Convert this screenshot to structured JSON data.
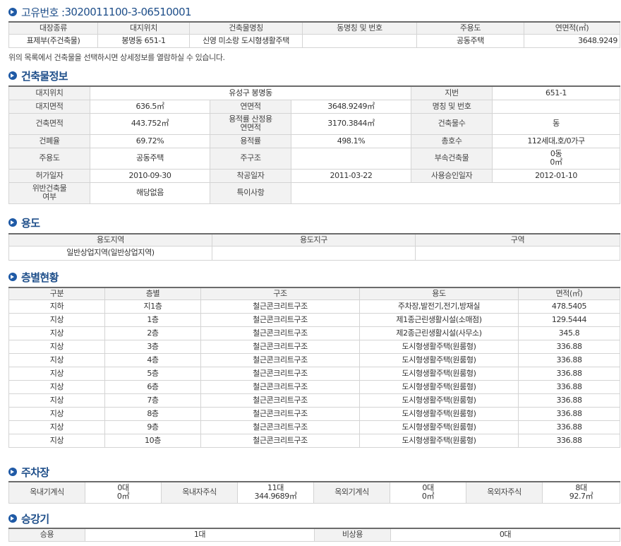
{
  "unique_id": {
    "label": "고유번호 : ",
    "value": "3020011100-3-06510001"
  },
  "summary": {
    "headers": [
      "대장종류",
      "대지위치",
      "건축물명칭",
      "동명칭 및 번호",
      "주용도",
      "연면적(㎡)"
    ],
    "row": [
      "표제부(주건축물)",
      "봉명동 651-1",
      "신영 미소랑 도시형생활주택",
      "",
      "공동주택",
      "3648.9249"
    ],
    "note": "위의 목록에서 건축물을 선택하시면 상세정보를 열람하실 수 있습니다."
  },
  "building": {
    "title": "건축물정보",
    "site_label": "대지위치",
    "site_value": "유성구 봉명동",
    "lot_label": "지번",
    "lot_value": "651-1",
    "land_area_label": "대지면적",
    "land_area_value": "636.5㎡",
    "floor_area_label": "연면적",
    "floor_area_value": "3648.9249㎡",
    "name_label": "명칭 및 번호",
    "name_value": "",
    "building_area_label": "건축면적",
    "building_area_value": "443.752㎡",
    "far_area_label_1": "용적률 산정용",
    "far_area_label_2": "연면적",
    "far_area_value": "3170.3844㎡",
    "bldg_count_label": "건축물수",
    "bldg_count_value": "동",
    "bcr_label": "건폐율",
    "bcr_value": "69.72%",
    "far_label": "용적률",
    "far_value": "498.1%",
    "units_label": "총호수",
    "units_value": "112세대,호/0가구",
    "use_label": "주용도",
    "use_value": "공동주택",
    "structure_label": "주구조",
    "structure_value": "",
    "annex_label": "부속건축물",
    "annex_value_1": "0동",
    "annex_value_2": "0㎡",
    "permit_label": "허가일자",
    "permit_value": "2010-09-30",
    "start_label": "착공일자",
    "start_value": "2011-03-22",
    "approval_label": "사용승인일자",
    "approval_value": "2012-01-10",
    "violation_label_1": "위반건축물",
    "violation_label_2": "여부",
    "violation_value": "해당없음",
    "special_label": "특이사항",
    "special_value": ""
  },
  "zoning": {
    "title": "용도",
    "headers": [
      "용도지역",
      "용도지구",
      "구역"
    ],
    "row": [
      "일반상업지역(일반상업지역)",
      "",
      ""
    ]
  },
  "floors": {
    "title": "층별현황",
    "headers": [
      "구분",
      "층별",
      "구조",
      "용도",
      "면적(㎡)"
    ],
    "rows": [
      [
        "지하",
        "지1층",
        "철근콘크리트구조",
        "주차장,발전기,전기,방재실",
        "478.5405"
      ],
      [
        "지상",
        "1층",
        "철근콘크리트구조",
        "제1종근린생활시설(소매점)",
        "129.5444"
      ],
      [
        "지상",
        "2층",
        "철근콘크리트구조",
        "제2종근린생활시설(사무소)",
        "345.8"
      ],
      [
        "지상",
        "3층",
        "철근콘크리트구조",
        "도시형생활주택(원룸형)",
        "336.88"
      ],
      [
        "지상",
        "4층",
        "철근콘크리트구조",
        "도시형생활주택(원룸형)",
        "336.88"
      ],
      [
        "지상",
        "5층",
        "철근콘크리트구조",
        "도시형생활주택(원룸형)",
        "336.88"
      ],
      [
        "지상",
        "6층",
        "철근콘크리트구조",
        "도시형생활주택(원룸형)",
        "336.88"
      ],
      [
        "지상",
        "7층",
        "철근콘크리트구조",
        "도시형생활주택(원룸형)",
        "336.88"
      ],
      [
        "지상",
        "8층",
        "철근콘크리트구조",
        "도시형생활주택(원룸형)",
        "336.88"
      ],
      [
        "지상",
        "9층",
        "철근콘크리트구조",
        "도시형생활주택(원룸형)",
        "336.88"
      ],
      [
        "지상",
        "10층",
        "철근콘크리트구조",
        "도시형생활주택(원룸형)",
        "336.88"
      ]
    ]
  },
  "parking": {
    "title": "주차장",
    "indoor_mech_label": "옥내기계식",
    "indoor_mech_count": "0대",
    "indoor_mech_area": "0㎡",
    "indoor_self_label": "옥내자주식",
    "indoor_self_count": "11대",
    "indoor_self_area": "344.9689㎡",
    "outdoor_mech_label": "옥외기계식",
    "outdoor_mech_count": "0대",
    "outdoor_mech_area": "0㎡",
    "outdoor_self_label": "옥외자주식",
    "outdoor_self_count": "8대",
    "outdoor_self_area": "92.7㎡"
  },
  "elevator": {
    "title": "승강기",
    "passenger_label": "승용",
    "passenger_value": "1대",
    "emergency_label": "비상용",
    "emergency_value": "0대"
  },
  "colors": {
    "accent": "#1f5aa6",
    "header_bg": "#f2f2f2",
    "border": "#d4d4d4"
  },
  "icons": {
    "section_bullet": "circle-arrow-icon"
  }
}
